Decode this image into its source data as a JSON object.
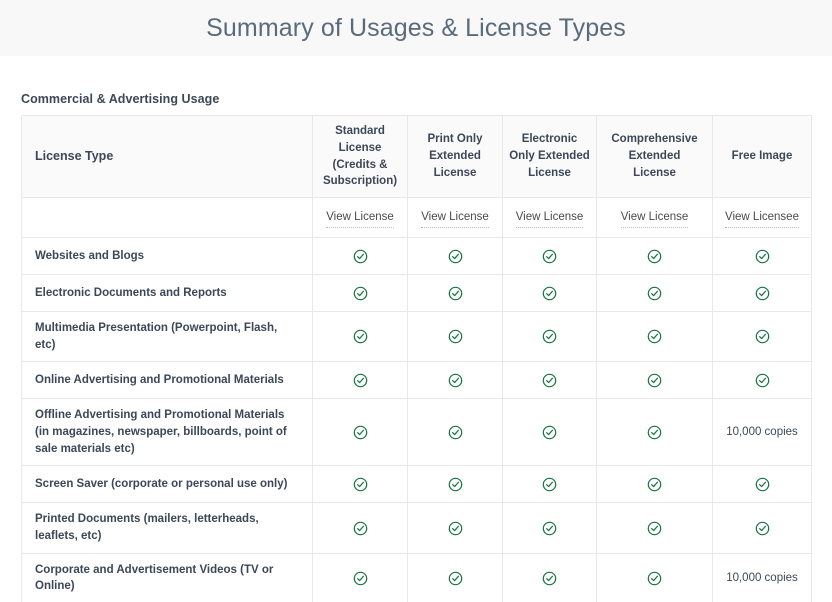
{
  "header": {
    "title": "Summary of Usages & License Types"
  },
  "section": {
    "label": "Commercial & Advertising Usage"
  },
  "colors": {
    "check_green": "#17743f",
    "header_band": "#f8f8f8",
    "title_text": "#5a6b7b",
    "body_text": "#3c4858",
    "border": "#e8e8e8"
  },
  "table": {
    "columns": [
      {
        "key": "type",
        "label": "License Type",
        "view_label": ""
      },
      {
        "key": "std",
        "label": "Standard License (Credits & Subscription)",
        "view_label": "View License"
      },
      {
        "key": "print",
        "label": "Print Only Extended License",
        "view_label": "View License"
      },
      {
        "key": "elec",
        "label": "Electronic Only Extended License",
        "view_label": "View License"
      },
      {
        "key": "comp",
        "label": "Comprehensive Extended License",
        "view_label": "View License"
      },
      {
        "key": "free",
        "label": "Free Image",
        "view_label": "View Licensee"
      }
    ],
    "column_label_lines": {
      "type": [
        "License Type"
      ],
      "std": [
        "Standard",
        "License",
        "(Credits &",
        "Subscription)"
      ],
      "print": [
        "Print Only",
        "Extended",
        "License"
      ],
      "elec": [
        "Electronic",
        "Only Extended",
        "License"
      ],
      "comp": [
        "Comprehensive",
        "Extended",
        "License"
      ],
      "free": [
        "Free Image"
      ]
    },
    "check_icon_name": "check-circle-icon",
    "rows": [
      {
        "label": "Websites and Blogs",
        "cells": [
          "check",
          "check",
          "check",
          "check",
          "check"
        ]
      },
      {
        "label": "Electronic Documents and Reports",
        "cells": [
          "check",
          "check",
          "check",
          "check",
          "check"
        ]
      },
      {
        "label": "Multimedia Presentation (Powerpoint, Flash, etc)",
        "cells": [
          "check",
          "check",
          "check",
          "check",
          "check"
        ]
      },
      {
        "label": "Online Advertising and Promotional Materials",
        "cells": [
          "check",
          "check",
          "check",
          "check",
          "check"
        ]
      },
      {
        "label": "Offline Advertising and Promotional Materials (in magazines, newspaper, billboards, point of sale materials etc)",
        "cells": [
          "check",
          "check",
          "check",
          "check",
          "10,000 copies"
        ]
      },
      {
        "label": "Screen Saver (corporate or personal use only)",
        "cells": [
          "check",
          "check",
          "check",
          "check",
          "check"
        ]
      },
      {
        "label": "Printed Documents (mailers, letterheads, leaflets, etc)",
        "cells": [
          "check",
          "check",
          "check",
          "check",
          "check"
        ]
      },
      {
        "label": "Corporate and Advertisement Videos (TV or Online)",
        "cells": [
          "check",
          "check",
          "check",
          "check",
          "10,000 copies"
        ]
      }
    ]
  }
}
